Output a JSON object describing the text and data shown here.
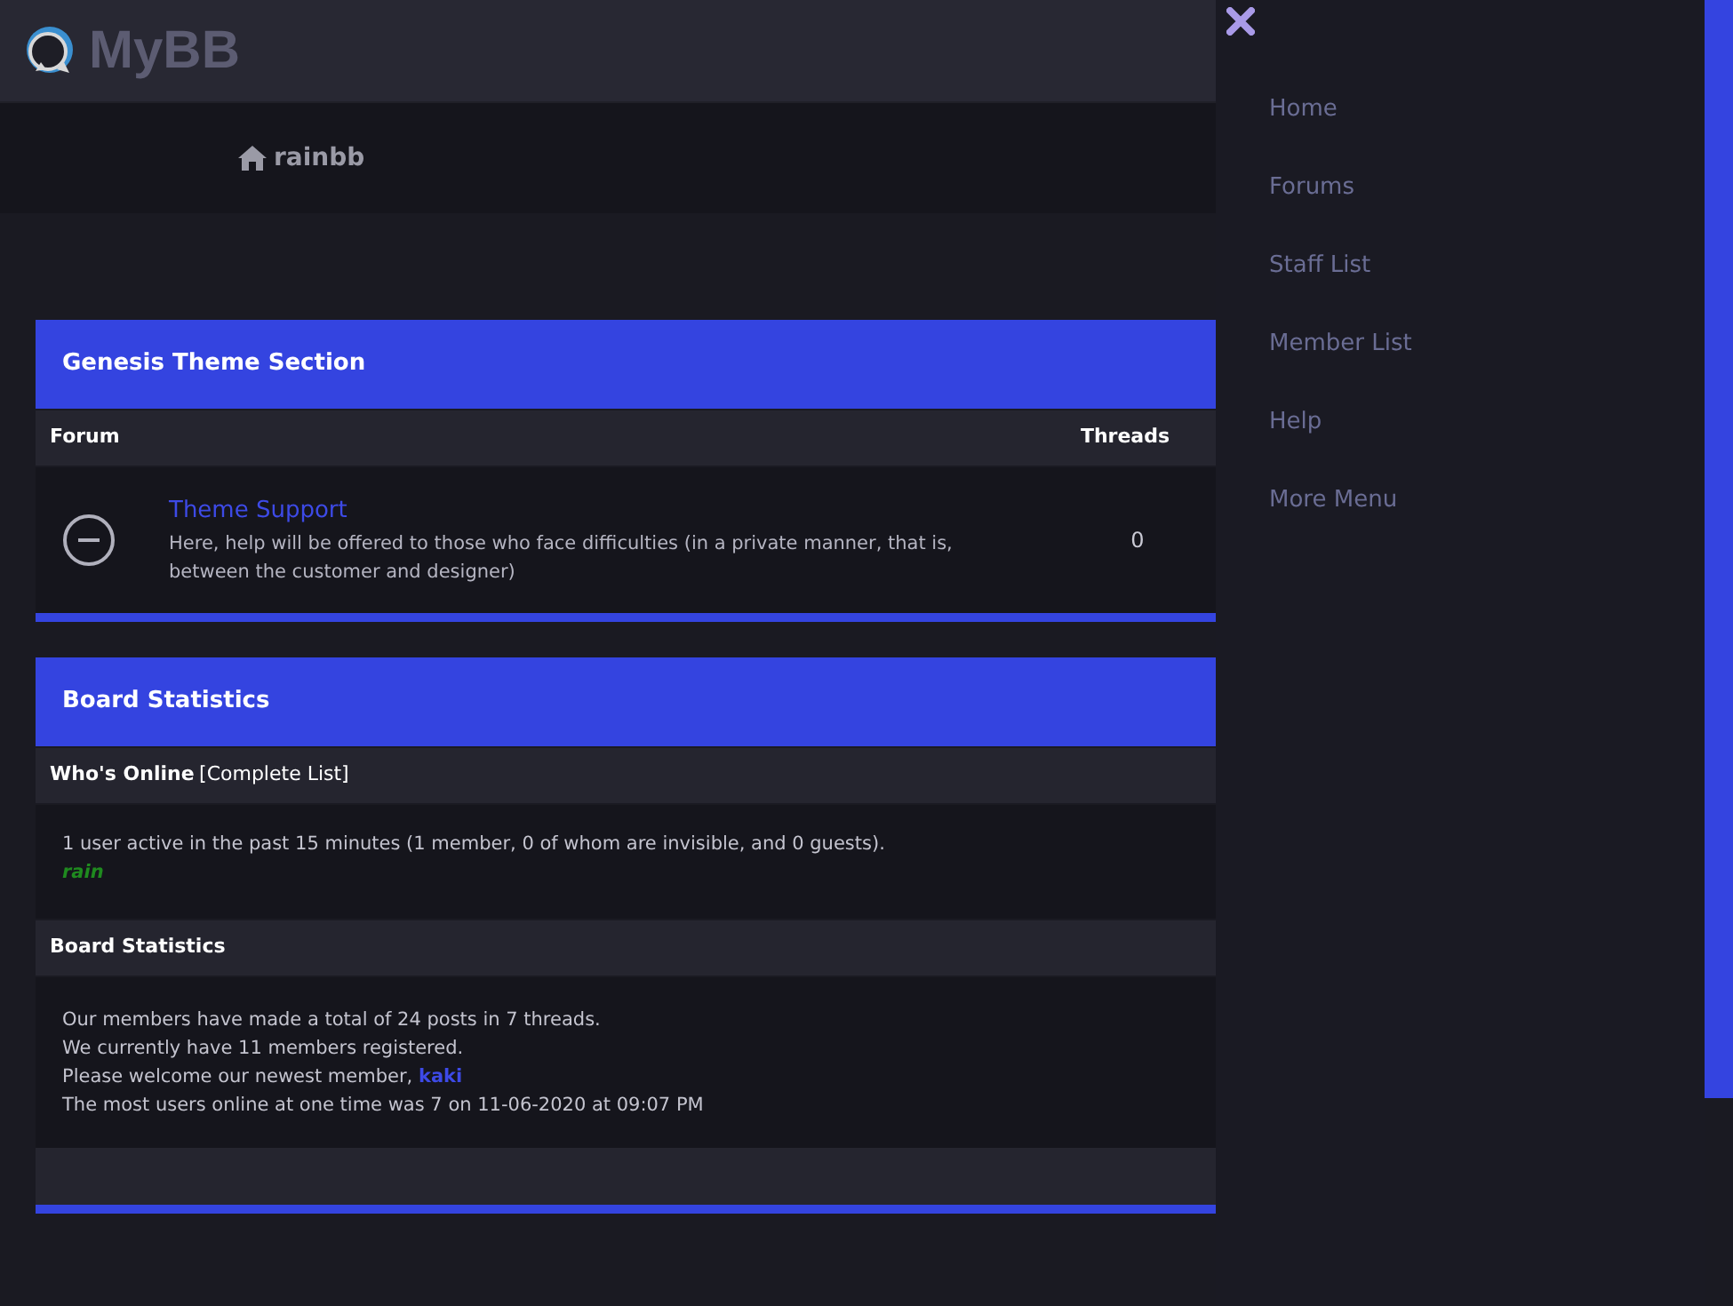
{
  "logo": {
    "text": "MyBB"
  },
  "breadcrumb": {
    "text": "rainbb"
  },
  "forum_category": {
    "title": "Genesis Theme Section",
    "columns": [
      "Forum",
      "Threads"
    ],
    "forums": [
      {
        "name": "Theme Support",
        "description": "Here, help will be offered to those who face difficulties (in a private manner, that is, between the customer and designer)",
        "threads": "0"
      }
    ]
  },
  "board_stats": {
    "title": "Board Statistics",
    "whos_online": {
      "heading": "Who's Online",
      "link": "[Complete List]",
      "summary": "1 user active in the past 15 minutes (1 member, 0 of whom are invisible, and 0 guests).",
      "users": [
        {
          "name": "rain",
          "color": "#1f8a1f"
        }
      ]
    },
    "statistics": {
      "heading": "Board Statistics",
      "lines": [
        {
          "text": "Our members have made a total of 24 posts in 7 threads."
        },
        {
          "text": "We currently have 11 members registered."
        },
        {
          "text": "Please welcome our newest member, ",
          "link": "kaki"
        },
        {
          "text": "The most users online at one time was 7 on 11-06-2020 at 09:07 PM"
        }
      ]
    }
  },
  "side_menu": {
    "items": [
      "Home",
      "Forums",
      "Staff List",
      "Member List",
      "Help",
      "More Menu"
    ]
  }
}
